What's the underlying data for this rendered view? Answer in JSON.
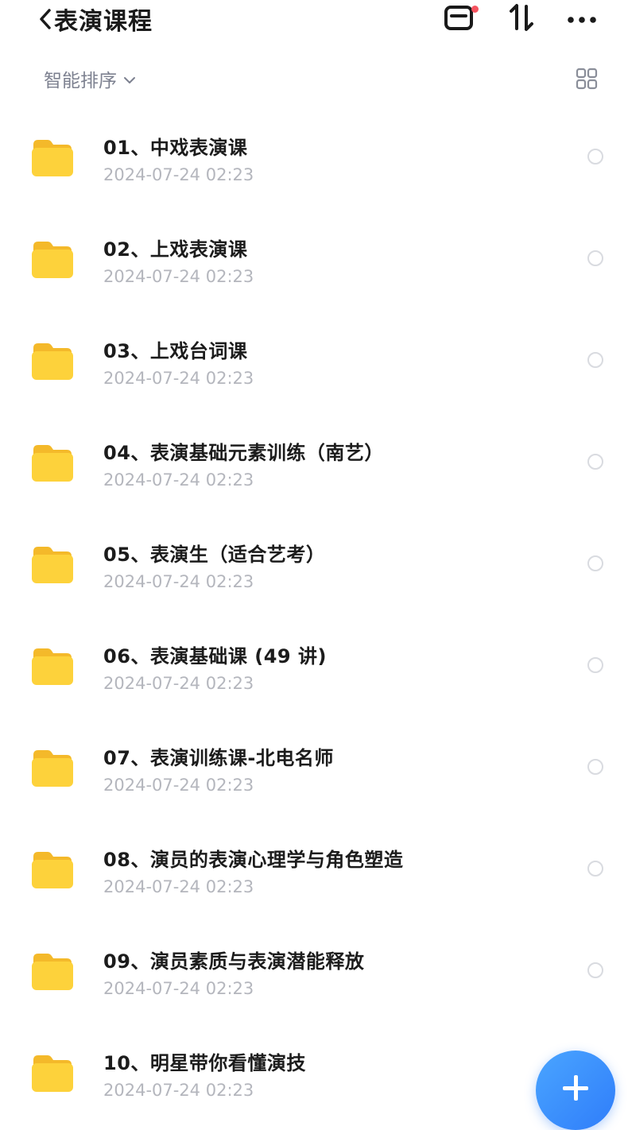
{
  "header": {
    "title": "表演课程",
    "icons": [
      "back-chevron-icon",
      "transfer-list-icon",
      "sort-arrows-icon",
      "more-icon"
    ]
  },
  "toolbar": {
    "sort_label": "智能排序",
    "sort_icon": "chevron-down-icon",
    "view_icon": "grid-view-icon"
  },
  "files": [
    {
      "name": "01、中戏表演课",
      "date": "2024-07-24 02:23"
    },
    {
      "name": "02、上戏表演课",
      "date": "2024-07-24 02:23"
    },
    {
      "name": "03、上戏台词课",
      "date": "2024-07-24 02:23"
    },
    {
      "name": "04、表演基础元素训练（南艺）",
      "date": "2024-07-24 02:23"
    },
    {
      "name": "05、表演生（适合艺考）",
      "date": "2024-07-24 02:23"
    },
    {
      "name": "06、表演基础课 (49 讲)",
      "date": "2024-07-24 02:23"
    },
    {
      "name": "07、表演训练课-北电名师",
      "date": "2024-07-24 02:23"
    },
    {
      "name": "08、演员的表演心理学与角色塑造",
      "date": "2024-07-24 02:23"
    },
    {
      "name": "09、演员素质与表演潜能释放",
      "date": "2024-07-24 02:23"
    },
    {
      "name": "10、明星带你看懂演技",
      "date": "2024-07-24 02:23"
    }
  ],
  "colors": {
    "folder": "#fdd23b",
    "accent": "#2f7dfa",
    "notify_dot": "#f5535f",
    "date_text": "#b4b6bd"
  }
}
